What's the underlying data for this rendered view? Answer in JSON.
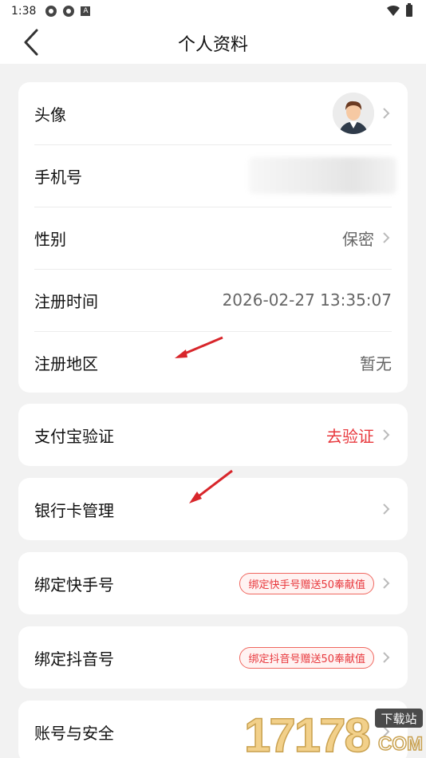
{
  "status_bar": {
    "time": "1:38"
  },
  "header": {
    "title": "个人资料"
  },
  "profile_card": {
    "avatar_label": "头像",
    "phone_label": "手机号",
    "gender_label": "性别",
    "gender_value": "保密",
    "reg_time_label": "注册时间",
    "reg_time_value": "2026-02-27 13:35:07",
    "reg_region_label": "注册地区",
    "reg_region_value": "暂无"
  },
  "alipay": {
    "label": "支付宝验证",
    "action": "去验证"
  },
  "bank": {
    "label": "银行卡管理"
  },
  "kuaishou": {
    "label": "绑定快手号",
    "badge": "绑定快手号赠送50奉献值"
  },
  "douyin": {
    "label": "绑定抖音号",
    "badge": "绑定抖音号赠送50奉献值"
  },
  "security": {
    "label": "账号与安全"
  },
  "watermark": {
    "number": "17178",
    "site": "下载站",
    "domain": "COM"
  },
  "colors": {
    "accent_red": "#e8383d",
    "badge_border": "#f0675f",
    "background": "#f2f2f2"
  }
}
